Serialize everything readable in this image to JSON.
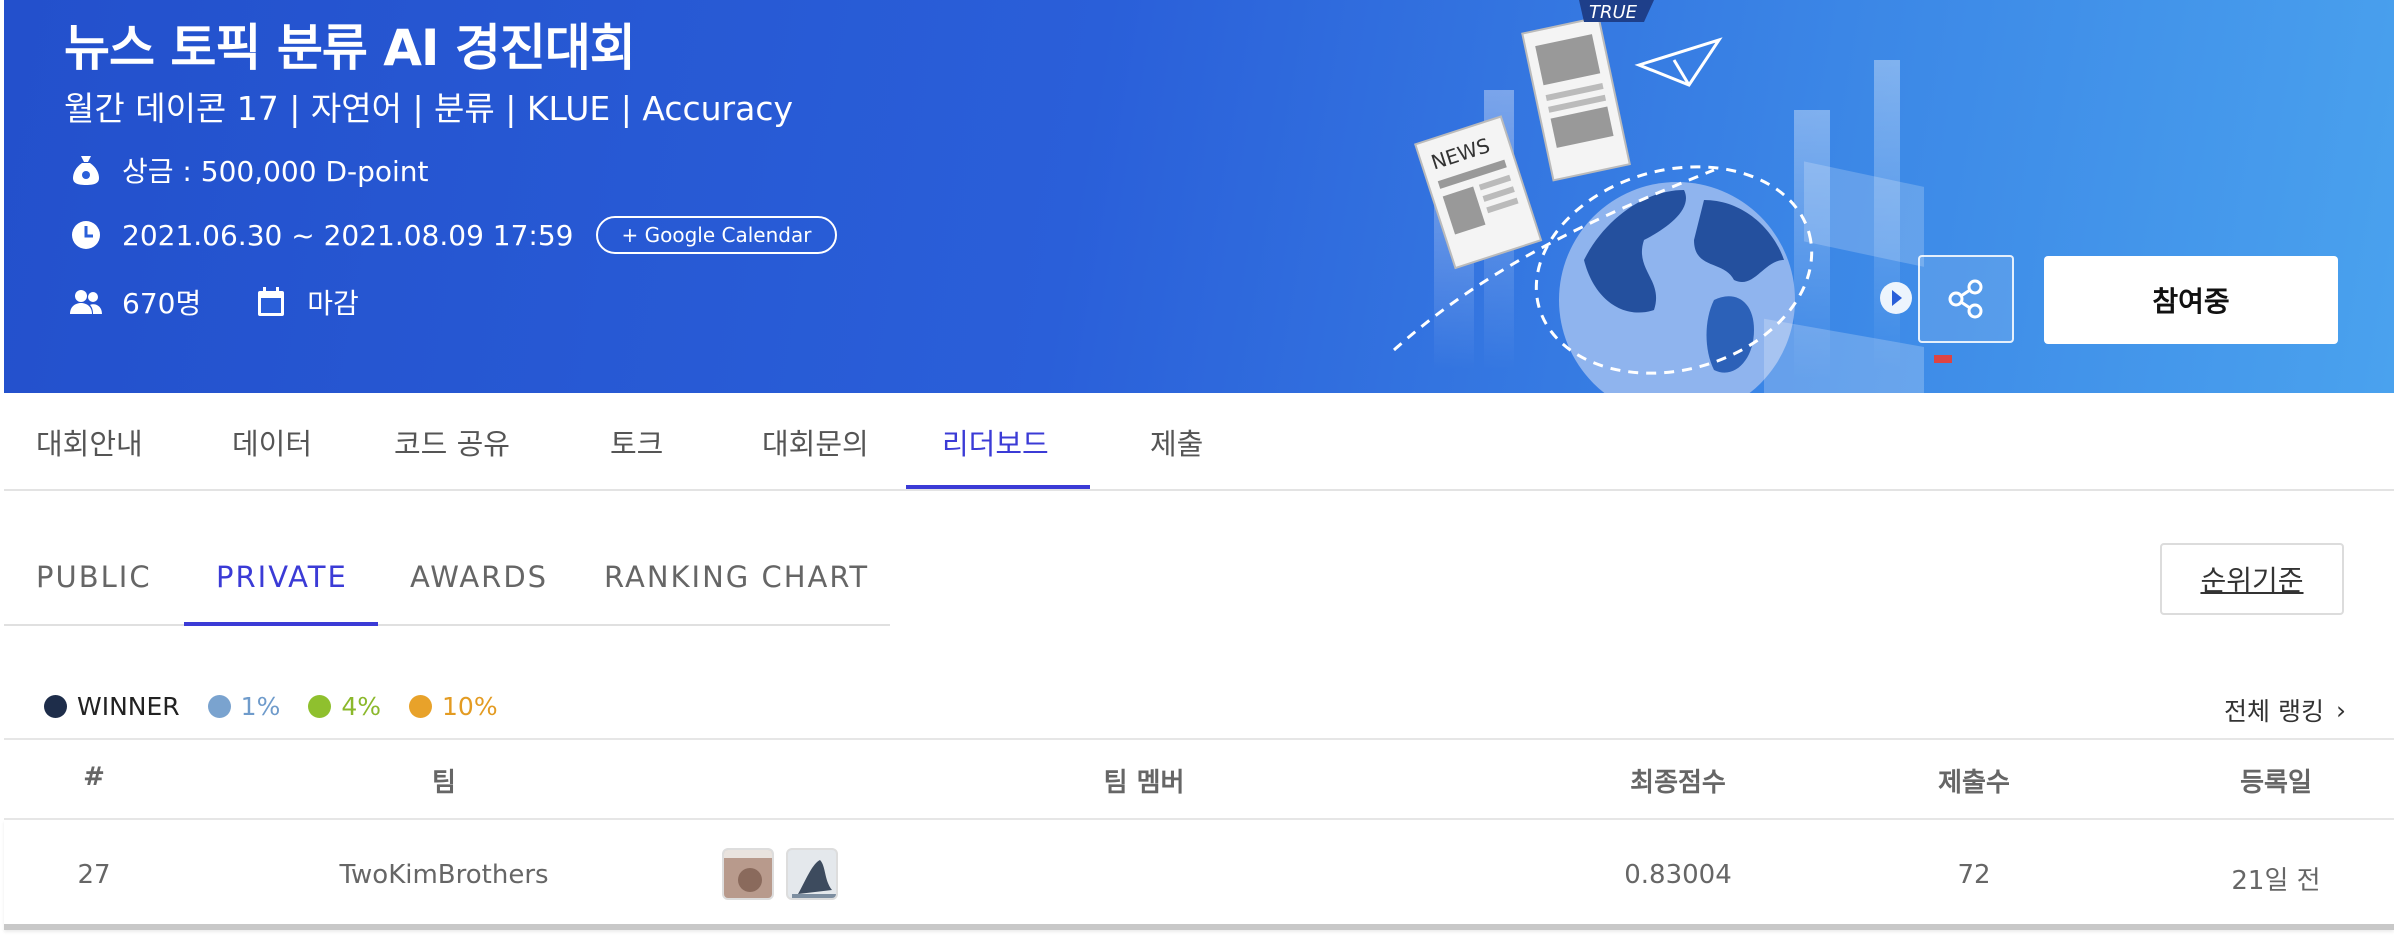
{
  "banner": {
    "title": "뉴스 토픽 분류 AI 경진대회",
    "subtitle": "월간 데이콘 17 | 자연어 | 분류 | KLUE | Accuracy",
    "prize": "상금 : 500,000 D-point",
    "period": "2021.06.30 ~ 2021.08.09 17:59",
    "calendar_button": "+ Google Calendar",
    "participants": "670명",
    "status": "마감",
    "join_button": "참여중",
    "art_text": {
      "news": "NEWS",
      "true": "TRUE"
    },
    "icons": [
      "money-bag-icon",
      "clock-icon",
      "people-icon",
      "calendar-icon",
      "share-icon"
    ]
  },
  "main_tabs": [
    {
      "label": "대회안내"
    },
    {
      "label": "데이터"
    },
    {
      "label": "코드 공유"
    },
    {
      "label": "토크"
    },
    {
      "label": "대회문의"
    },
    {
      "label": "리더보드",
      "active": true
    },
    {
      "label": "제출"
    }
  ],
  "sub_tabs": [
    {
      "label": "PUBLIC"
    },
    {
      "label": "PRIVATE",
      "active": true
    },
    {
      "label": "AWARDS"
    },
    {
      "label": "RANKING CHART"
    }
  ],
  "rank_criteria_button": "순위기준",
  "legend": [
    {
      "label": "WINNER",
      "color": "#1e2d4a",
      "text_color": "#222222"
    },
    {
      "label": "1%",
      "color": "#7aa3cf",
      "text_color": "#6f9bcb"
    },
    {
      "label": "4%",
      "color": "#8fc02e",
      "text_color": "#8bb82b"
    },
    {
      "label": "10%",
      "color": "#e8a22a",
      "text_color": "#e39b22"
    }
  ],
  "full_ranking_link": "전체 랭킹",
  "table": {
    "headers": {
      "rank": "#",
      "team": "팀",
      "members": "팀 멤버",
      "score": "최종점수",
      "submissions": "제출수",
      "date": "등록일"
    },
    "rows": [
      {
        "rank": "27",
        "team": "TwoKimBrothers",
        "score": "0.83004",
        "submissions": "72",
        "date": "21일 전"
      }
    ]
  },
  "colors": {
    "accent": "#3b3bd6",
    "banner": "#2a5fd9"
  }
}
